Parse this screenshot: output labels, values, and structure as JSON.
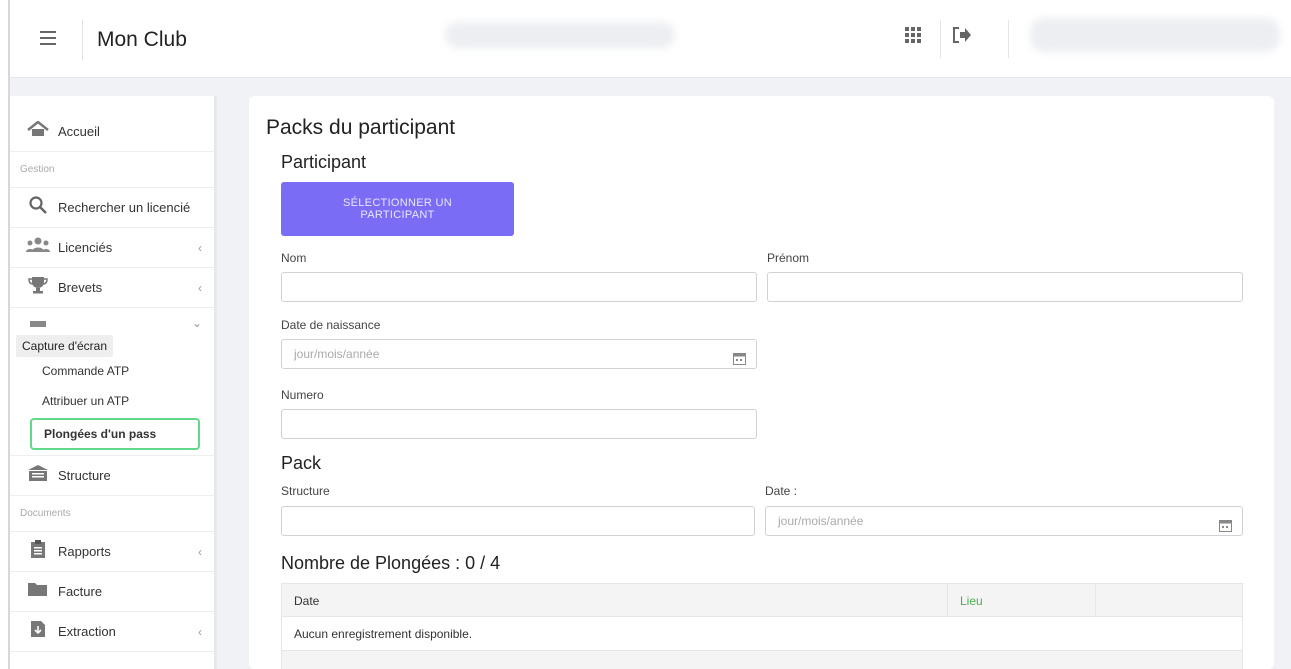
{
  "header": {
    "app_title": "Mon Club",
    "icons": [
      "menu-icon",
      "apps-grid-icon",
      "logout-icon"
    ]
  },
  "sidebar": {
    "items": [
      {
        "label": "Accueil",
        "icon": "home-icon"
      },
      {
        "section": "Gestion"
      },
      {
        "label": "Rechercher un licencié",
        "icon": "search-icon"
      },
      {
        "label": "Licenciés",
        "icon": "users-icon",
        "chevron": "‹"
      },
      {
        "label": "Brevets",
        "icon": "trophy-icon",
        "chevron": "‹"
      }
    ],
    "tooltip": "Capture d'écran",
    "atp_chevron": "⌄",
    "sub_items": [
      "Commande ATP",
      "Attribuer un ATP",
      "Plongées d'un pass"
    ],
    "after": [
      {
        "label": "Structure",
        "icon": "building-icon"
      },
      {
        "section": "Documents"
      },
      {
        "label": "Rapports",
        "icon": "clipboard-icon",
        "chevron": "‹"
      },
      {
        "label": "Facture",
        "icon": "folder-icon"
      },
      {
        "label": "Extraction",
        "icon": "download-file-icon",
        "chevron": "‹"
      }
    ]
  },
  "main": {
    "title": "Packs du participant",
    "participant_heading": "Participant",
    "select_button": "SÉLECTIONNER UN PARTICIPANT",
    "nom_label": "Nom",
    "prenom_label": "Prénom",
    "dob_label": "Date de naissance",
    "dob_placeholder": "jour/mois/année",
    "numero_label": "Numero",
    "pack_heading": "Pack",
    "structure_label": "Structure",
    "date_label": "Date :",
    "date_placeholder": "jour/mois/année",
    "dives_heading": "Nombre de Plongées : 0 / 4",
    "table": {
      "columns": [
        "Date",
        "Lieu",
        ""
      ],
      "empty_message": "Aucun enregistrement disponible."
    }
  },
  "colors": {
    "accent": "#7b6cf6",
    "active_border": "#63d88b",
    "lieu_header": "#4caf50"
  }
}
